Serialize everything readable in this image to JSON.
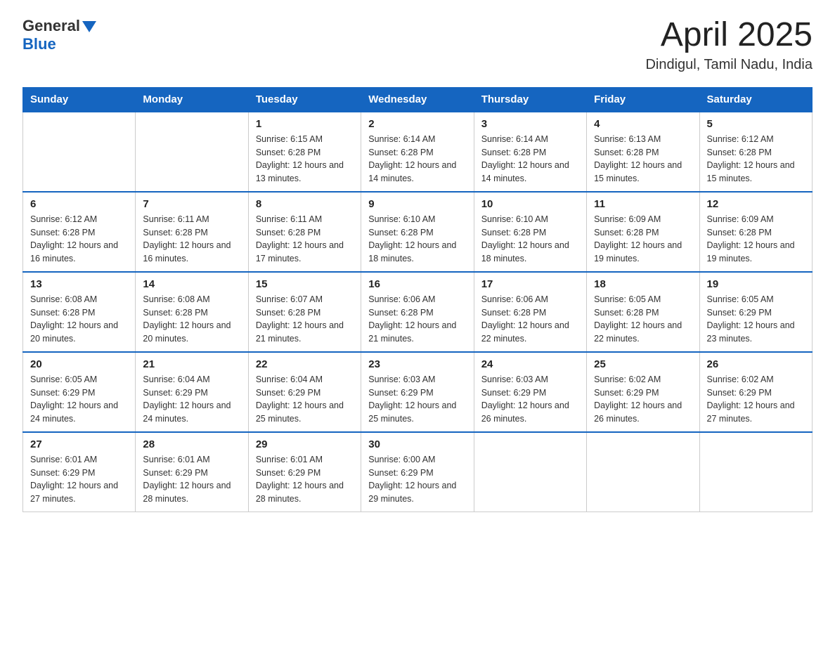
{
  "header": {
    "logo": {
      "general": "General",
      "blue": "Blue"
    },
    "title": "April 2025",
    "subtitle": "Dindigul, Tamil Nadu, India"
  },
  "calendar": {
    "days": [
      "Sunday",
      "Monday",
      "Tuesday",
      "Wednesday",
      "Thursday",
      "Friday",
      "Saturday"
    ],
    "weeks": [
      [
        {
          "day": "",
          "info": ""
        },
        {
          "day": "",
          "info": ""
        },
        {
          "day": "1",
          "info": "Sunrise: 6:15 AM\nSunset: 6:28 PM\nDaylight: 12 hours and 13 minutes."
        },
        {
          "day": "2",
          "info": "Sunrise: 6:14 AM\nSunset: 6:28 PM\nDaylight: 12 hours and 14 minutes."
        },
        {
          "day": "3",
          "info": "Sunrise: 6:14 AM\nSunset: 6:28 PM\nDaylight: 12 hours and 14 minutes."
        },
        {
          "day": "4",
          "info": "Sunrise: 6:13 AM\nSunset: 6:28 PM\nDaylight: 12 hours and 15 minutes."
        },
        {
          "day": "5",
          "info": "Sunrise: 6:12 AM\nSunset: 6:28 PM\nDaylight: 12 hours and 15 minutes."
        }
      ],
      [
        {
          "day": "6",
          "info": "Sunrise: 6:12 AM\nSunset: 6:28 PM\nDaylight: 12 hours and 16 minutes."
        },
        {
          "day": "7",
          "info": "Sunrise: 6:11 AM\nSunset: 6:28 PM\nDaylight: 12 hours and 16 minutes."
        },
        {
          "day": "8",
          "info": "Sunrise: 6:11 AM\nSunset: 6:28 PM\nDaylight: 12 hours and 17 minutes."
        },
        {
          "day": "9",
          "info": "Sunrise: 6:10 AM\nSunset: 6:28 PM\nDaylight: 12 hours and 18 minutes."
        },
        {
          "day": "10",
          "info": "Sunrise: 6:10 AM\nSunset: 6:28 PM\nDaylight: 12 hours and 18 minutes."
        },
        {
          "day": "11",
          "info": "Sunrise: 6:09 AM\nSunset: 6:28 PM\nDaylight: 12 hours and 19 minutes."
        },
        {
          "day": "12",
          "info": "Sunrise: 6:09 AM\nSunset: 6:28 PM\nDaylight: 12 hours and 19 minutes."
        }
      ],
      [
        {
          "day": "13",
          "info": "Sunrise: 6:08 AM\nSunset: 6:28 PM\nDaylight: 12 hours and 20 minutes."
        },
        {
          "day": "14",
          "info": "Sunrise: 6:08 AM\nSunset: 6:28 PM\nDaylight: 12 hours and 20 minutes."
        },
        {
          "day": "15",
          "info": "Sunrise: 6:07 AM\nSunset: 6:28 PM\nDaylight: 12 hours and 21 minutes."
        },
        {
          "day": "16",
          "info": "Sunrise: 6:06 AM\nSunset: 6:28 PM\nDaylight: 12 hours and 21 minutes."
        },
        {
          "day": "17",
          "info": "Sunrise: 6:06 AM\nSunset: 6:28 PM\nDaylight: 12 hours and 22 minutes."
        },
        {
          "day": "18",
          "info": "Sunrise: 6:05 AM\nSunset: 6:28 PM\nDaylight: 12 hours and 22 minutes."
        },
        {
          "day": "19",
          "info": "Sunrise: 6:05 AM\nSunset: 6:29 PM\nDaylight: 12 hours and 23 minutes."
        }
      ],
      [
        {
          "day": "20",
          "info": "Sunrise: 6:05 AM\nSunset: 6:29 PM\nDaylight: 12 hours and 24 minutes."
        },
        {
          "day": "21",
          "info": "Sunrise: 6:04 AM\nSunset: 6:29 PM\nDaylight: 12 hours and 24 minutes."
        },
        {
          "day": "22",
          "info": "Sunrise: 6:04 AM\nSunset: 6:29 PM\nDaylight: 12 hours and 25 minutes."
        },
        {
          "day": "23",
          "info": "Sunrise: 6:03 AM\nSunset: 6:29 PM\nDaylight: 12 hours and 25 minutes."
        },
        {
          "day": "24",
          "info": "Sunrise: 6:03 AM\nSunset: 6:29 PM\nDaylight: 12 hours and 26 minutes."
        },
        {
          "day": "25",
          "info": "Sunrise: 6:02 AM\nSunset: 6:29 PM\nDaylight: 12 hours and 26 minutes."
        },
        {
          "day": "26",
          "info": "Sunrise: 6:02 AM\nSunset: 6:29 PM\nDaylight: 12 hours and 27 minutes."
        }
      ],
      [
        {
          "day": "27",
          "info": "Sunrise: 6:01 AM\nSunset: 6:29 PM\nDaylight: 12 hours and 27 minutes."
        },
        {
          "day": "28",
          "info": "Sunrise: 6:01 AM\nSunset: 6:29 PM\nDaylight: 12 hours and 28 minutes."
        },
        {
          "day": "29",
          "info": "Sunrise: 6:01 AM\nSunset: 6:29 PM\nDaylight: 12 hours and 28 minutes."
        },
        {
          "day": "30",
          "info": "Sunrise: 6:00 AM\nSunset: 6:29 PM\nDaylight: 12 hours and 29 minutes."
        },
        {
          "day": "",
          "info": ""
        },
        {
          "day": "",
          "info": ""
        },
        {
          "day": "",
          "info": ""
        }
      ]
    ]
  }
}
